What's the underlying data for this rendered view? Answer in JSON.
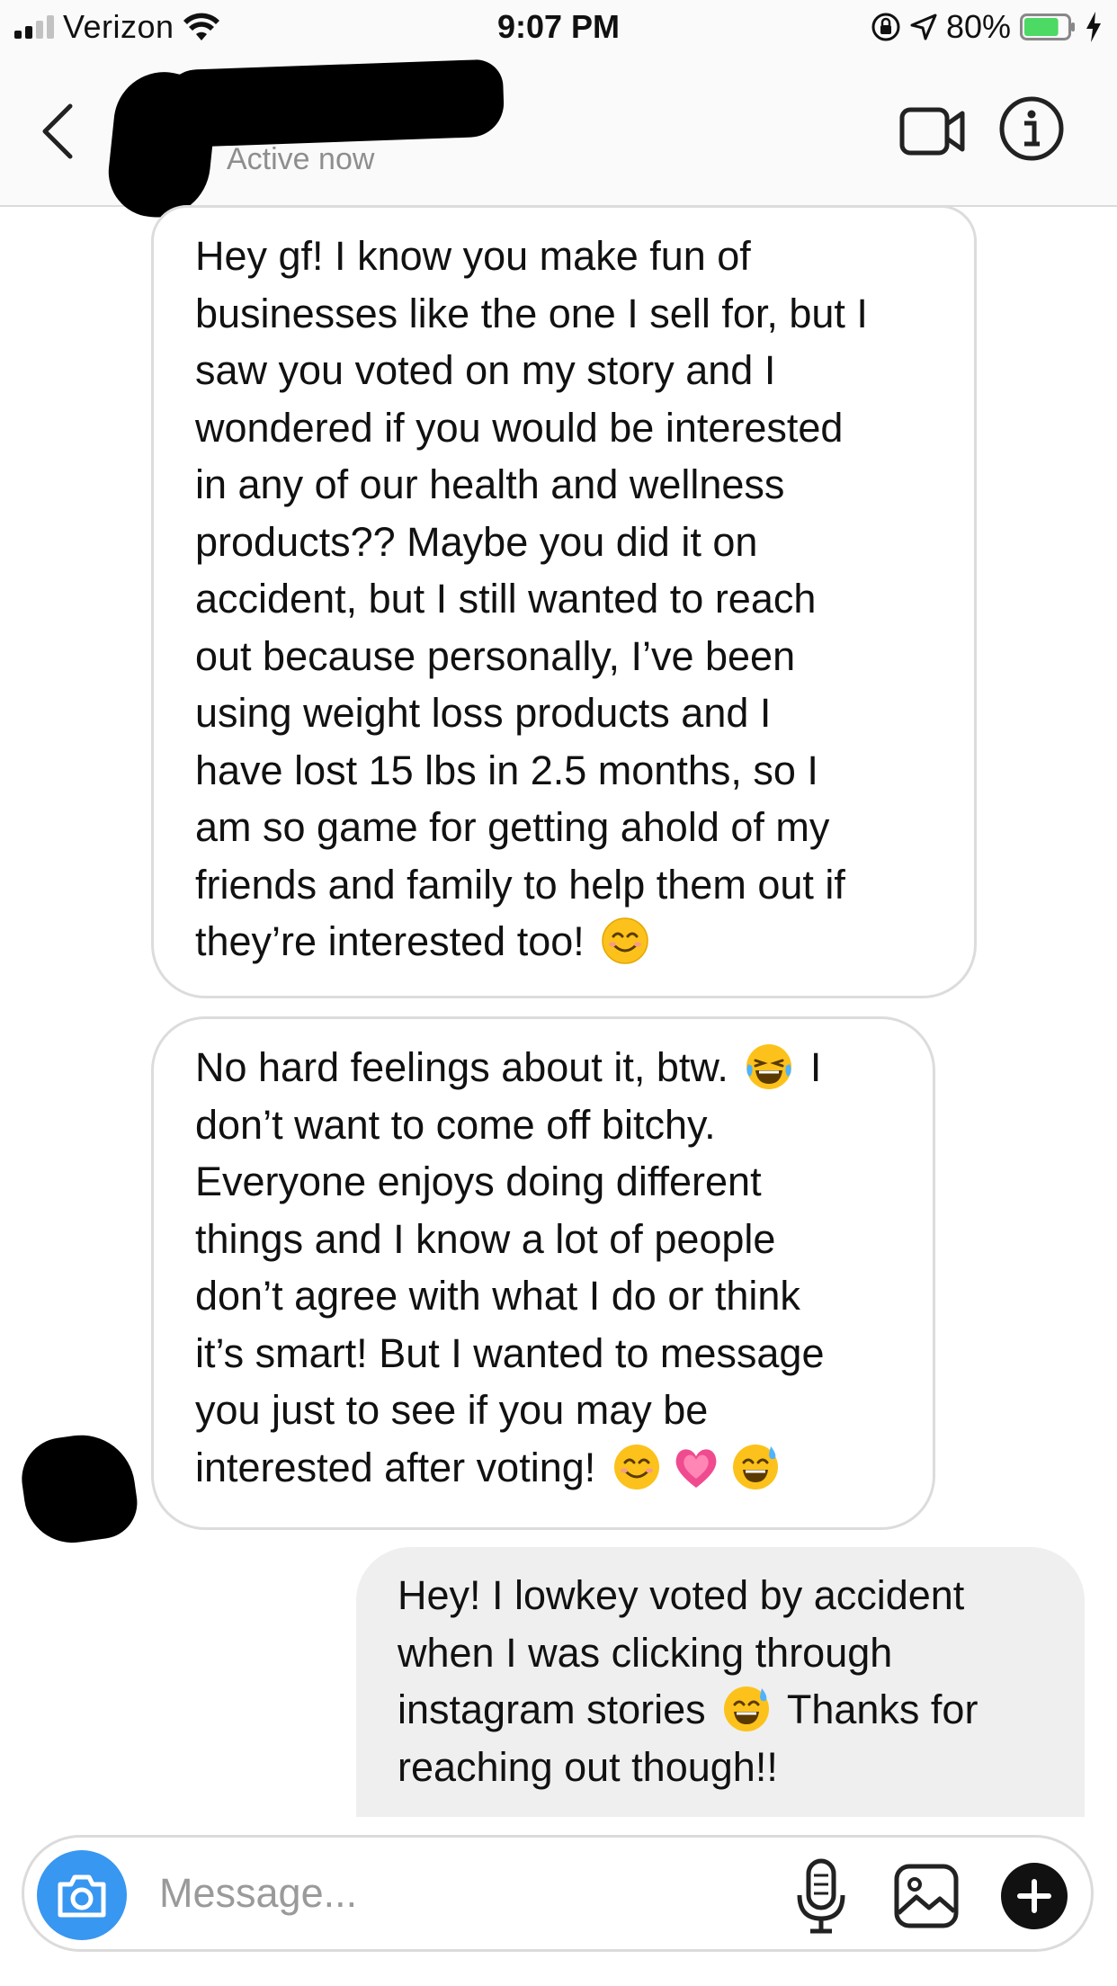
{
  "status_bar": {
    "carrier": "Verizon",
    "time": "9:07 PM",
    "battery_percent": "80%",
    "battery_level": 0.8,
    "signal_bars": 2,
    "signal_bars_total": 4
  },
  "header": {
    "status": "Active now",
    "icons": [
      "back-chevron-icon",
      "video-call-icon",
      "info-icon"
    ]
  },
  "messages": [
    {
      "direction": "incoming",
      "lines": [
        "Hey gf! I know you make fun of",
        "businesses like the one I sell for, but I",
        "saw you voted on my story and I",
        "wondered if you would be interested",
        "in any of our health and wellness",
        "products?? Maybe you did it on",
        "accident, but I still wanted to reach",
        "out because personally, I’ve been",
        "using weight loss products and I",
        "have lost 15 lbs in 2.5 months, so I",
        "am so game for getting ahold of my",
        "friends and family to help them out if",
        "they’re interested too!"
      ],
      "emojis": [
        "smiling-face-emoji"
      ]
    },
    {
      "direction": "incoming",
      "lines": [
        "No hard feelings about it, btw.",
        "I",
        "don’t want to come off bitchy.",
        "Everyone enjoys doing different",
        "things and I know a lot of people",
        "don’t agree with what I do or think",
        "it’s smart! But I wanted to message",
        "you just to see if you may be",
        "interested after voting!"
      ],
      "emojis": [
        "laughing-tears-emoji",
        "smiling-face-emoji",
        "growing-heart-emoji",
        "sweat-smile-emoji"
      ]
    },
    {
      "direction": "outgoing",
      "lines": [
        "Hey! I lowkey voted by accident",
        "when I was clicking through",
        "instagram stories",
        "Thanks for",
        "reaching out though!!"
      ],
      "emojis": [
        "sweat-smile-emoji"
      ]
    }
  ],
  "composer": {
    "placeholder": "Message...",
    "value": ""
  },
  "colors": {
    "accent_blue": "#3897f0",
    "incoming_border": "#dcdcdc",
    "outgoing_bg": "#efefef",
    "battery_green": "#4cd964"
  }
}
